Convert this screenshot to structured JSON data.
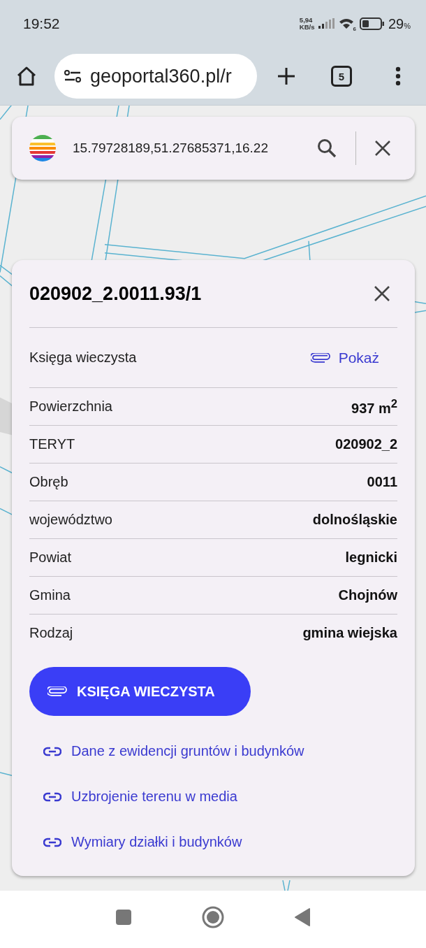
{
  "status_bar": {
    "time": "19:52",
    "speed": "5,94",
    "speed_unit": "KB/s",
    "wifi_badge": "6",
    "battery": "29",
    "battery_unit": "%"
  },
  "browser": {
    "url": "geoportal360.pl/r",
    "tab_count": "5"
  },
  "search": {
    "value": "15.79728189,51.27685371,16.22"
  },
  "parcel": {
    "title": "020902_2.0011.93/1",
    "land_register": {
      "label": "Księga wieczysta",
      "link": "Pokaż"
    },
    "rows": [
      {
        "label": "Powierzchnia",
        "value": "937 m$^{2}$"
      },
      {
        "label": "TERYT",
        "value": "020902_2"
      },
      {
        "label": "Obręb",
        "value": "0011"
      },
      {
        "label": "województwo",
        "value": "dolnośląskie"
      },
      {
        "label": "Powiat",
        "value": "legnicki"
      },
      {
        "label": "Gmina",
        "value": "Chojnów"
      },
      {
        "label": "Rodzaj",
        "value": "gmina wiejska"
      }
    ],
    "button": "KSIĘGA WIECZYSTA",
    "links": [
      "Dane z ewidencji gruntów i budynków",
      "Uzbrojenie terenu w media",
      "Wymiary działki i budynków"
    ]
  }
}
